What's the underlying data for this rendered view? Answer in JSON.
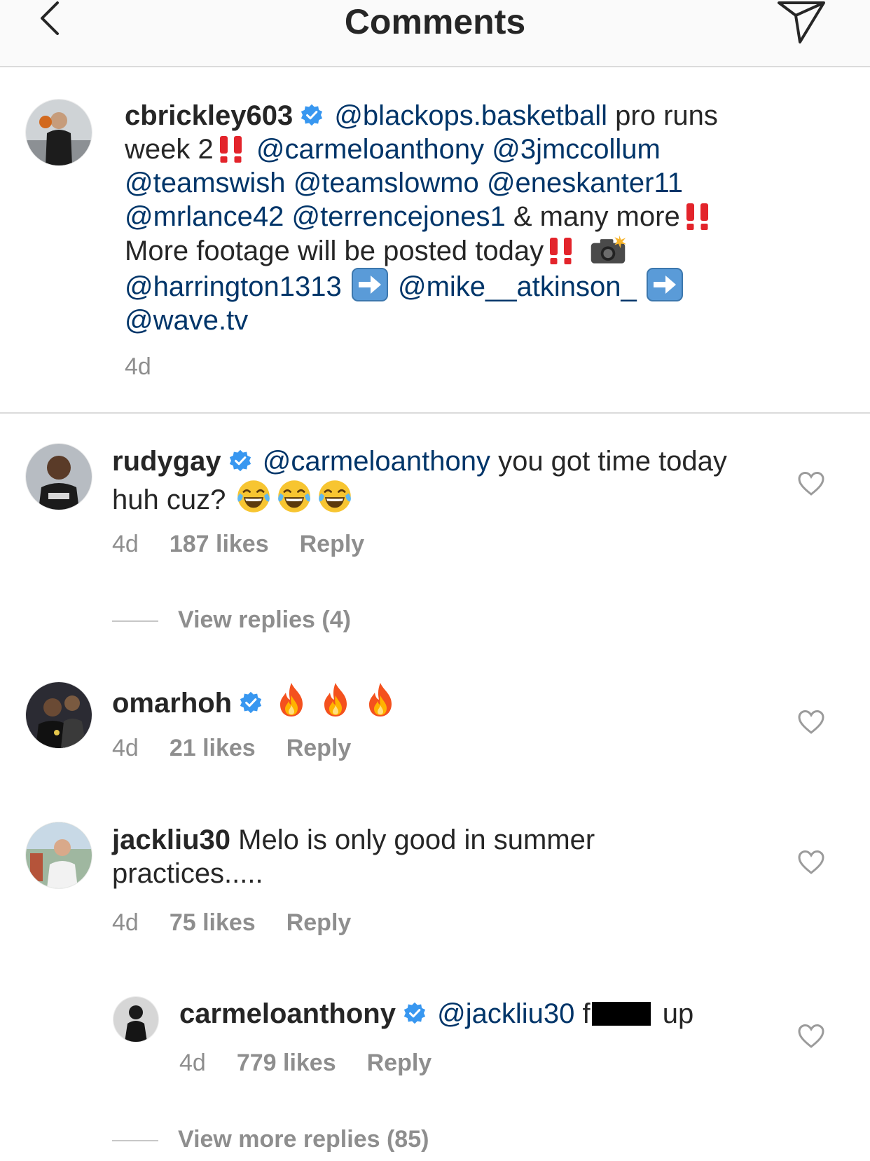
{
  "header": {
    "title": "Comments"
  },
  "caption": {
    "username": "cbrickley603",
    "text_a": "@blackops.basketball",
    "text_b": " pro runs week 2",
    "text_c": "@carmeloanthony",
    "text_d": "@3jmccollum",
    "text_e": "@teamswish",
    "text_f": "@teamslowmo",
    "text_g": "@eneskanter11",
    "text_h": "@mrlance42",
    "text_i": "@terrencejones1",
    "text_j": " & many more",
    "text_k": " More footage will be posted today",
    "text_l": "@harrington1313",
    "text_m": "@mike__atkinson_",
    "text_n": "@wave.tv",
    "time": "4d"
  },
  "comments": [
    {
      "username": "rudygay",
      "mention": "@carmeloanthony",
      "text": " you got time today huh cuz?",
      "time": "4d",
      "likes": "187 likes",
      "reply": "Reply",
      "view_replies": "View replies (4)"
    },
    {
      "username": "omarhoh",
      "time": "4d",
      "likes": "21 likes",
      "reply": "Reply"
    },
    {
      "username": "jackliu30",
      "text": " Melo is only good in summer practices.....",
      "time": "4d",
      "likes": "75 likes",
      "reply": "Reply"
    }
  ],
  "reply": {
    "username": "carmeloanthony",
    "mention": "@jackliu30",
    "text_before": " f",
    "text_after": " up",
    "time": "4d",
    "likes": "779 likes",
    "reply": "Reply",
    "view_more": "View more replies (85)"
  },
  "colors": {
    "link": "#003569",
    "muted": "#8e8e8e",
    "verified": "#3897f0",
    "divider": "#dbdbdb"
  },
  "icons": [
    "back-chevron-icon",
    "send-direct-icon",
    "verified-badge-icon",
    "heart-outline-icon",
    "double-exclamation-emoji",
    "camera-flash-emoji",
    "right-arrow-emoji",
    "tears-of-joy-emoji",
    "fire-emoji"
  ]
}
